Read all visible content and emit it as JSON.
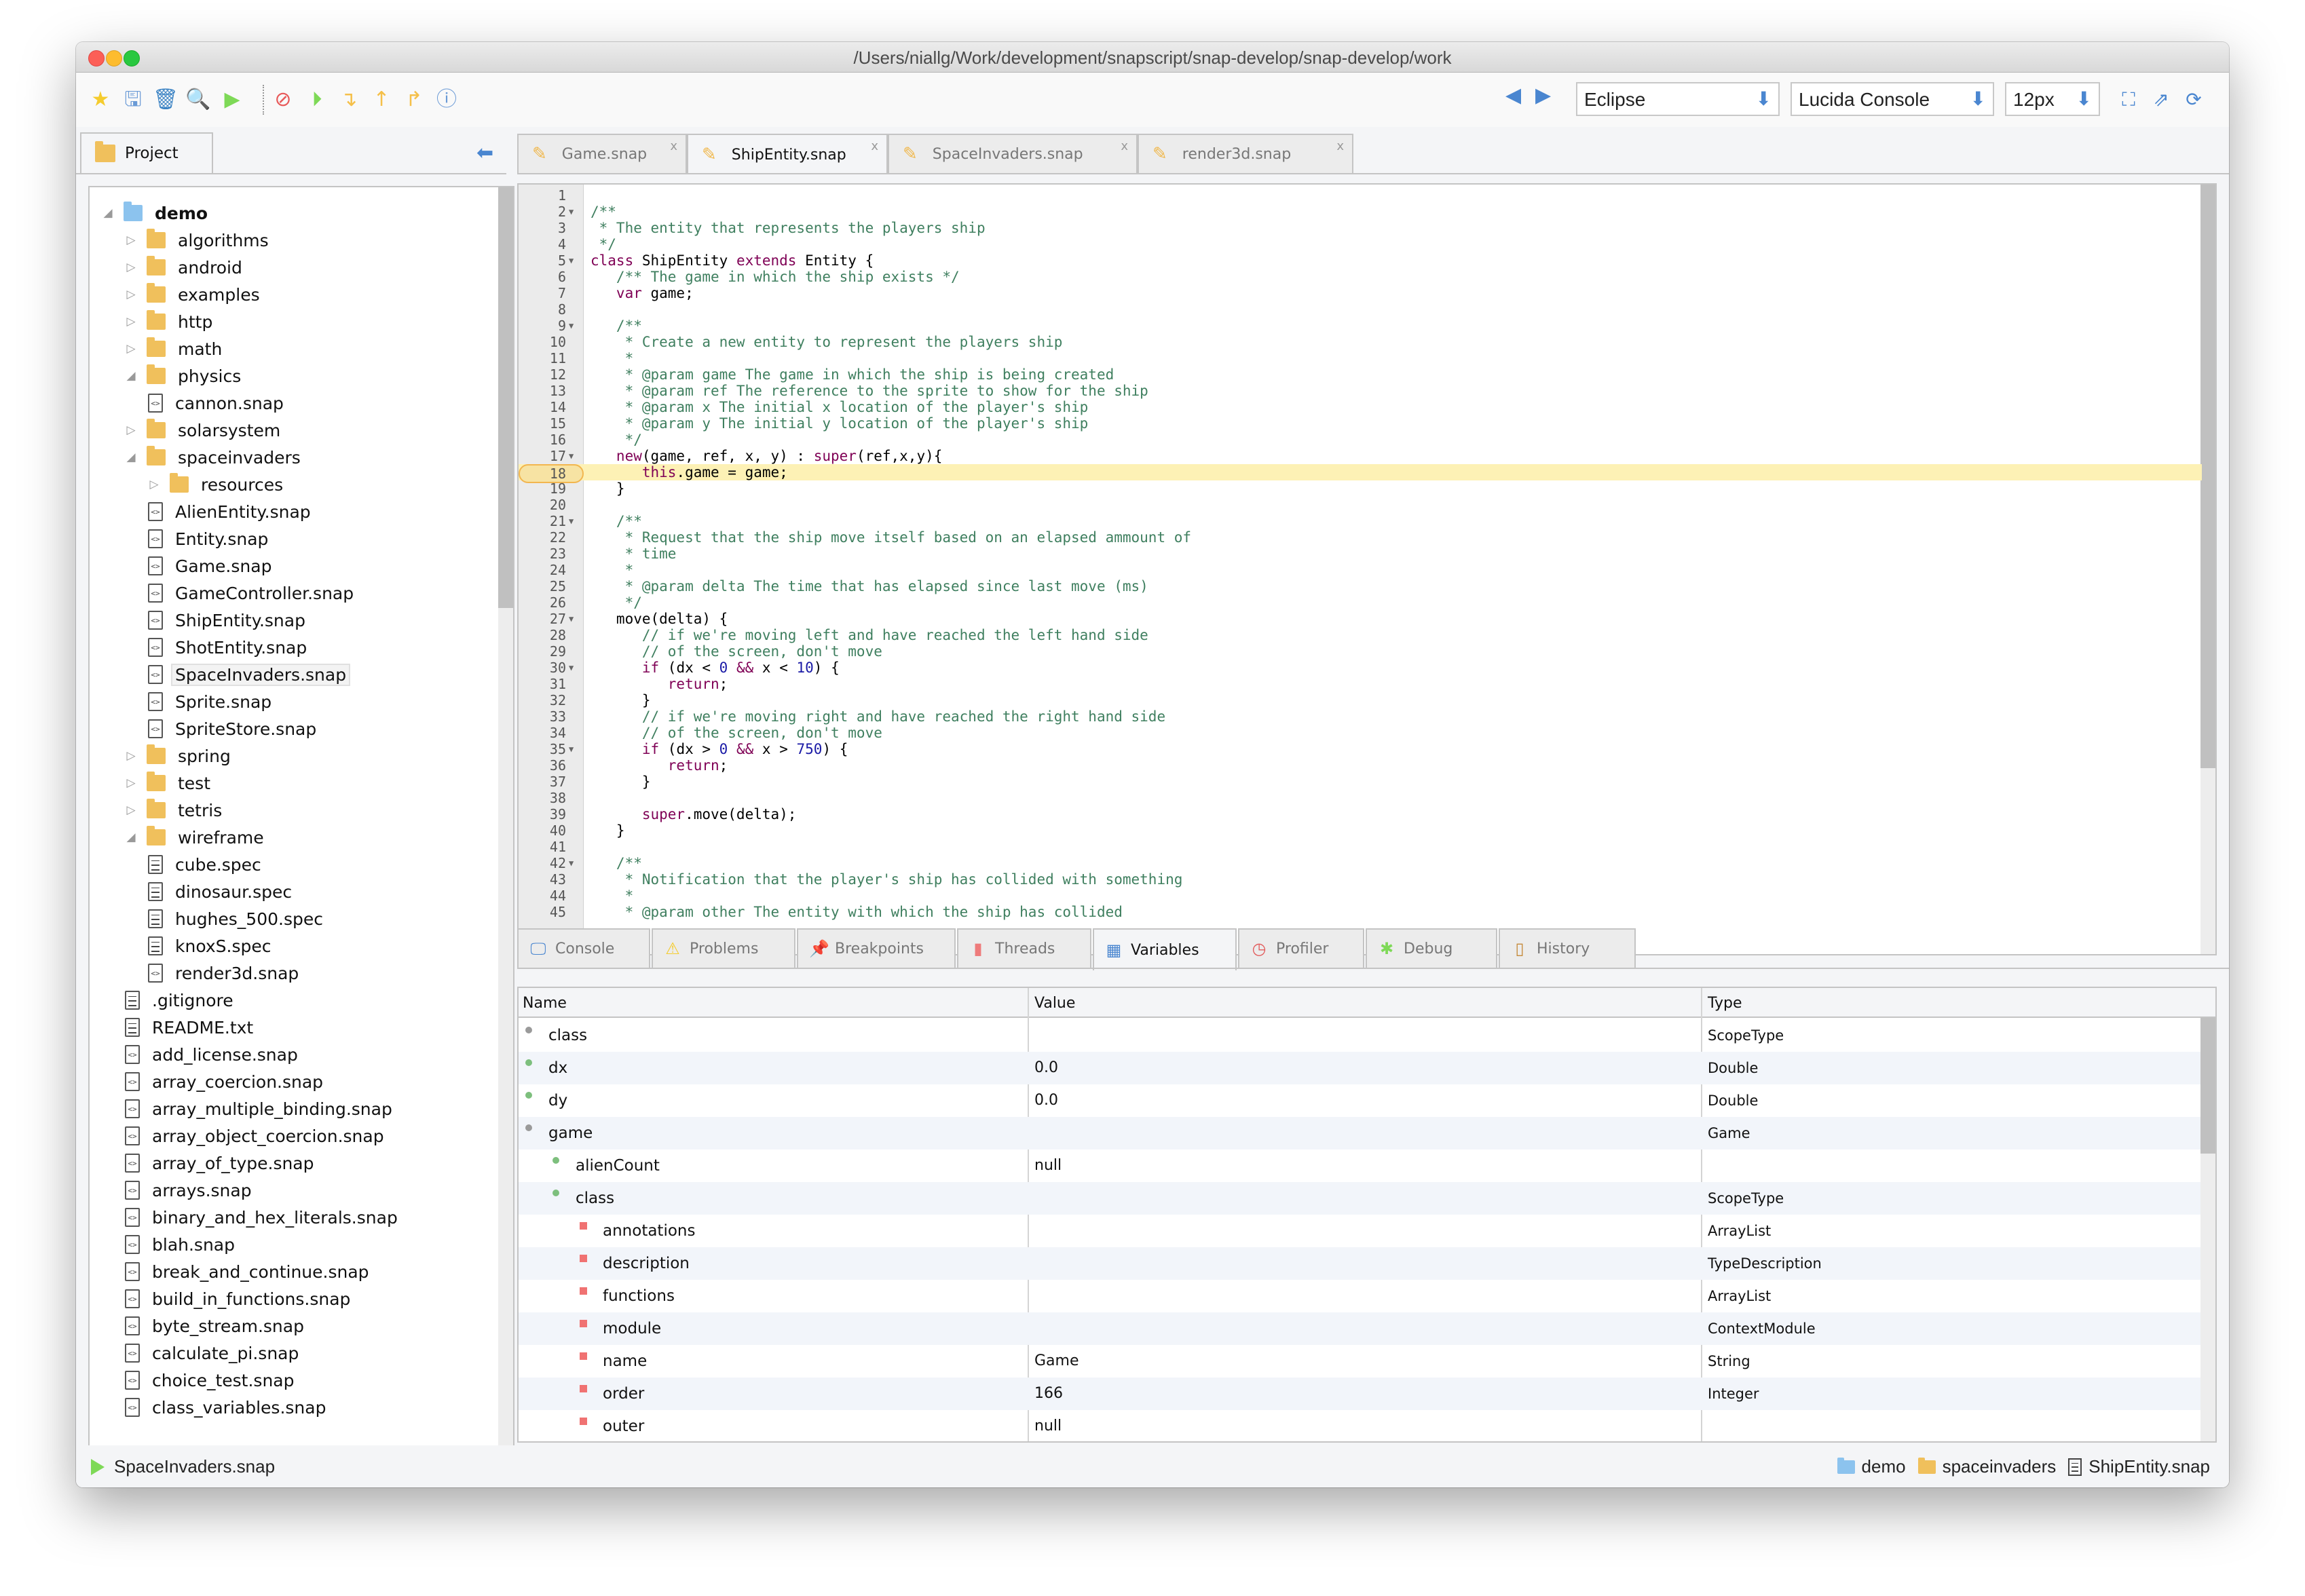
{
  "window": {
    "title": "/Users/niallg/Work/development/snapscript/snap-develop/snap-develop/work"
  },
  "toolbar": {
    "icons": [
      {
        "name": "star-icon",
        "glyph": "★",
        "color": "#f5cc2e"
      },
      {
        "name": "save-icon",
        "glyph": "🖫",
        "color": "#6a9ad6"
      },
      {
        "name": "trash-icon",
        "glyph": "🗑",
        "color": "#3b83c4"
      },
      {
        "name": "search-icon",
        "glyph": "🔍",
        "color": "#d48a3a"
      },
      {
        "name": "run-icon",
        "glyph": "▶",
        "color": "#7ed957"
      },
      {
        "name": "stop-icon",
        "glyph": "⊘",
        "color": "#e85a5a"
      },
      {
        "name": "resume-icon",
        "glyph": "⏵",
        "color": "#7ed957"
      },
      {
        "name": "step-into-icon",
        "glyph": "↴",
        "color": "#f5c04a"
      },
      {
        "name": "step-out-icon",
        "glyph": "↑",
        "color": "#f5c04a"
      },
      {
        "name": "step-over-icon",
        "glyph": "↱",
        "color": "#f5c04a"
      },
      {
        "name": "help-icon",
        "glyph": "ⓘ",
        "color": "#6a9ad6"
      }
    ],
    "theme_select": "Eclipse",
    "font_select": "Lucida Console",
    "size_select": "12px",
    "back_glyph": "◀",
    "forward_glyph": "▶",
    "right_icons": [
      {
        "name": "fullscreen-icon",
        "glyph": "⛶"
      },
      {
        "name": "external-link-icon",
        "glyph": "⇗"
      },
      {
        "name": "refresh-icon",
        "glyph": "⟳"
      }
    ],
    "dropdown_arrow": "⬇"
  },
  "project_panel": {
    "tab_label": "Project",
    "collapse_glyph": "⬅",
    "tree": [
      {
        "label": "demo",
        "depth": 0,
        "type": "root",
        "toggle": "open",
        "bold": true
      },
      {
        "label": "algorithms",
        "depth": 1,
        "type": "folder",
        "toggle": "closed"
      },
      {
        "label": "android",
        "depth": 1,
        "type": "folder",
        "toggle": "closed"
      },
      {
        "label": "examples",
        "depth": 1,
        "type": "folder",
        "toggle": "closed"
      },
      {
        "label": "http",
        "depth": 1,
        "type": "folder",
        "toggle": "closed"
      },
      {
        "label": "math",
        "depth": 1,
        "type": "folder",
        "toggle": "closed"
      },
      {
        "label": "physics",
        "depth": 1,
        "type": "folder",
        "toggle": "open"
      },
      {
        "label": "cannon.snap",
        "depth": 2,
        "type": "code"
      },
      {
        "label": "solarsystem",
        "depth": 1,
        "type": "folder",
        "toggle": "closed"
      },
      {
        "label": "spaceinvaders",
        "depth": 1,
        "type": "folder",
        "toggle": "open"
      },
      {
        "label": "resources",
        "depth": 2,
        "type": "folder",
        "toggle": "closed"
      },
      {
        "label": "AlienEntity.snap",
        "depth": 2,
        "type": "code"
      },
      {
        "label": "Entity.snap",
        "depth": 2,
        "type": "code"
      },
      {
        "label": "Game.snap",
        "depth": 2,
        "type": "code"
      },
      {
        "label": "GameController.snap",
        "depth": 2,
        "type": "code"
      },
      {
        "label": "ShipEntity.snap",
        "depth": 2,
        "type": "code"
      },
      {
        "label": "ShotEntity.snap",
        "depth": 2,
        "type": "code"
      },
      {
        "label": "SpaceInvaders.snap",
        "depth": 2,
        "type": "code",
        "selected": true
      },
      {
        "label": "Sprite.snap",
        "depth": 2,
        "type": "code"
      },
      {
        "label": "SpriteStore.snap",
        "depth": 2,
        "type": "code"
      },
      {
        "label": "spring",
        "depth": 1,
        "type": "folder",
        "toggle": "closed"
      },
      {
        "label": "test",
        "depth": 1,
        "type": "folder",
        "toggle": "closed"
      },
      {
        "label": "tetris",
        "depth": 1,
        "type": "folder",
        "toggle": "closed"
      },
      {
        "label": "wireframe",
        "depth": 1,
        "type": "folder",
        "toggle": "open"
      },
      {
        "label": "cube.spec",
        "depth": 2,
        "type": "text"
      },
      {
        "label": "dinosaur.spec",
        "depth": 2,
        "type": "text"
      },
      {
        "label": "hughes_500.spec",
        "depth": 2,
        "type": "text"
      },
      {
        "label": "knoxS.spec",
        "depth": 2,
        "type": "text"
      },
      {
        "label": "render3d.snap",
        "depth": 2,
        "type": "code"
      },
      {
        "label": ".gitignore",
        "depth": 1,
        "type": "text"
      },
      {
        "label": "README.txt",
        "depth": 1,
        "type": "text"
      },
      {
        "label": "add_license.snap",
        "depth": 1,
        "type": "code"
      },
      {
        "label": "array_coercion.snap",
        "depth": 1,
        "type": "code"
      },
      {
        "label": "array_multiple_binding.snap",
        "depth": 1,
        "type": "code"
      },
      {
        "label": "array_object_coercion.snap",
        "depth": 1,
        "type": "code"
      },
      {
        "label": "array_of_type.snap",
        "depth": 1,
        "type": "code"
      },
      {
        "label": "arrays.snap",
        "depth": 1,
        "type": "code"
      },
      {
        "label": "binary_and_hex_literals.snap",
        "depth": 1,
        "type": "code"
      },
      {
        "label": "blah.snap",
        "depth": 1,
        "type": "code"
      },
      {
        "label": "break_and_continue.snap",
        "depth": 1,
        "type": "code"
      },
      {
        "label": "build_in_functions.snap",
        "depth": 1,
        "type": "code"
      },
      {
        "label": "byte_stream.snap",
        "depth": 1,
        "type": "code"
      },
      {
        "label": "calculate_pi.snap",
        "depth": 1,
        "type": "code"
      },
      {
        "label": "choice_test.snap",
        "depth": 1,
        "type": "code"
      },
      {
        "label": "class_variables.snap",
        "depth": 1,
        "type": "code"
      }
    ]
  },
  "editor_tabs": [
    {
      "label": "Game.snap",
      "active": false
    },
    {
      "label": "ShipEntity.snap",
      "active": true
    },
    {
      "label": "SpaceInvaders.snap",
      "active": false
    },
    {
      "label": "render3d.snap",
      "active": false
    }
  ],
  "editor_tab_close": "x",
  "editor": {
    "highlighted_line": 18,
    "lines": [
      {
        "n": 1,
        "fold": false,
        "seg": []
      },
      {
        "n": 2,
        "fold": true,
        "seg": [
          [
            "c",
            "/**"
          ]
        ]
      },
      {
        "n": 3,
        "fold": false,
        "seg": [
          [
            "c",
            " * The entity that represents the players ship"
          ]
        ]
      },
      {
        "n": 4,
        "fold": false,
        "seg": [
          [
            "c",
            " */"
          ]
        ]
      },
      {
        "n": 5,
        "fold": true,
        "seg": [
          [
            "k",
            "class"
          ],
          [
            "p",
            " ShipEntity "
          ],
          [
            "k",
            "extends"
          ],
          [
            "p",
            " Entity {"
          ]
        ]
      },
      {
        "n": 6,
        "fold": false,
        "seg": [
          [
            "c",
            "   /** The game in which the ship exists */"
          ]
        ]
      },
      {
        "n": 7,
        "fold": false,
        "seg": [
          [
            "k",
            "   var"
          ],
          [
            "p",
            " game;"
          ]
        ]
      },
      {
        "n": 8,
        "fold": false,
        "seg": []
      },
      {
        "n": 9,
        "fold": true,
        "seg": [
          [
            "c",
            "   /**"
          ]
        ]
      },
      {
        "n": 10,
        "fold": false,
        "seg": [
          [
            "c",
            "    * Create a new entity to represent the players ship"
          ]
        ]
      },
      {
        "n": 11,
        "fold": false,
        "seg": [
          [
            "c",
            "    *"
          ]
        ]
      },
      {
        "n": 12,
        "fold": false,
        "seg": [
          [
            "c",
            "    * @param game The game in which the ship is being created"
          ]
        ]
      },
      {
        "n": 13,
        "fold": false,
        "seg": [
          [
            "c",
            "    * @param ref The reference to the sprite to show for the ship"
          ]
        ]
      },
      {
        "n": 14,
        "fold": false,
        "seg": [
          [
            "c",
            "    * @param x The initial x location of the player's ship"
          ]
        ]
      },
      {
        "n": 15,
        "fold": false,
        "seg": [
          [
            "c",
            "    * @param y The initial y location of the player's ship"
          ]
        ]
      },
      {
        "n": 16,
        "fold": false,
        "seg": [
          [
            "c",
            "    */"
          ]
        ]
      },
      {
        "n": 17,
        "fold": true,
        "seg": [
          [
            "k",
            "   new"
          ],
          [
            "p",
            "(game, ref, x, y) : "
          ],
          [
            "k",
            "super"
          ],
          [
            "p",
            "(ref,x,y){"
          ]
        ]
      },
      {
        "n": 18,
        "fold": false,
        "seg": [
          [
            "k",
            "      this"
          ],
          [
            "p",
            ".game = game;"
          ]
        ]
      },
      {
        "n": 19,
        "fold": false,
        "seg": [
          [
            "p",
            "   }"
          ]
        ]
      },
      {
        "n": 20,
        "fold": false,
        "seg": []
      },
      {
        "n": 21,
        "fold": true,
        "seg": [
          [
            "c",
            "   /**"
          ]
        ]
      },
      {
        "n": 22,
        "fold": false,
        "seg": [
          [
            "c",
            "    * Request that the ship move itself based on an elapsed ammount of"
          ]
        ]
      },
      {
        "n": 23,
        "fold": false,
        "seg": [
          [
            "c",
            "    * time"
          ]
        ]
      },
      {
        "n": 24,
        "fold": false,
        "seg": [
          [
            "c",
            "    *"
          ]
        ]
      },
      {
        "n": 25,
        "fold": false,
        "seg": [
          [
            "c",
            "    * @param delta The time that has elapsed since last move (ms)"
          ]
        ]
      },
      {
        "n": 26,
        "fold": false,
        "seg": [
          [
            "c",
            "    */"
          ]
        ]
      },
      {
        "n": 27,
        "fold": true,
        "seg": [
          [
            "p",
            "   move(delta) {"
          ]
        ]
      },
      {
        "n": 28,
        "fold": false,
        "seg": [
          [
            "c",
            "      // if we're moving left and have reached the left hand side"
          ]
        ]
      },
      {
        "n": 29,
        "fold": false,
        "seg": [
          [
            "c",
            "      // of the screen, don't move"
          ]
        ]
      },
      {
        "n": 30,
        "fold": true,
        "seg": [
          [
            "k",
            "      if"
          ],
          [
            "p",
            " (dx < "
          ],
          [
            "n",
            "0"
          ],
          [
            "p",
            " "
          ],
          [
            "k",
            "&&"
          ],
          [
            "p",
            " x < "
          ],
          [
            "n",
            "10"
          ],
          [
            "p",
            ") {"
          ]
        ]
      },
      {
        "n": 31,
        "fold": false,
        "seg": [
          [
            "k",
            "         return"
          ],
          [
            "p",
            ";"
          ]
        ]
      },
      {
        "n": 32,
        "fold": false,
        "seg": [
          [
            "p",
            "      }"
          ]
        ]
      },
      {
        "n": 33,
        "fold": false,
        "seg": [
          [
            "c",
            "      // if we're moving right and have reached the right hand side"
          ]
        ]
      },
      {
        "n": 34,
        "fold": false,
        "seg": [
          [
            "c",
            "      // of the screen, don't move"
          ]
        ]
      },
      {
        "n": 35,
        "fold": true,
        "seg": [
          [
            "k",
            "      if"
          ],
          [
            "p",
            " (dx > "
          ],
          [
            "n",
            "0"
          ],
          [
            "p",
            " "
          ],
          [
            "k",
            "&&"
          ],
          [
            "p",
            " x > "
          ],
          [
            "n",
            "750"
          ],
          [
            "p",
            ") {"
          ]
        ]
      },
      {
        "n": 36,
        "fold": false,
        "seg": [
          [
            "k",
            "         return"
          ],
          [
            "p",
            ";"
          ]
        ]
      },
      {
        "n": 37,
        "fold": false,
        "seg": [
          [
            "p",
            "      }"
          ]
        ]
      },
      {
        "n": 38,
        "fold": false,
        "seg": []
      },
      {
        "n": 39,
        "fold": false,
        "seg": [
          [
            "k",
            "      super"
          ],
          [
            "p",
            ".move(delta);"
          ]
        ]
      },
      {
        "n": 40,
        "fold": false,
        "seg": [
          [
            "p",
            "   }"
          ]
        ]
      },
      {
        "n": 41,
        "fold": false,
        "seg": []
      },
      {
        "n": 42,
        "fold": true,
        "seg": [
          [
            "c",
            "   /**"
          ]
        ]
      },
      {
        "n": 43,
        "fold": false,
        "seg": [
          [
            "c",
            "    * Notification that the player's ship has collided with something"
          ]
        ]
      },
      {
        "n": 44,
        "fold": false,
        "seg": [
          [
            "c",
            "    *"
          ]
        ]
      },
      {
        "n": 45,
        "fold": false,
        "seg": [
          [
            "c",
            "    * @param other The entity with which the ship has collided"
          ]
        ]
      }
    ]
  },
  "bottom_tabs": [
    {
      "label": "Console",
      "icon": "console-icon",
      "glyph": "🖵",
      "color": "#4a86d0",
      "active": false
    },
    {
      "label": "Problems",
      "icon": "warning-icon",
      "glyph": "⚠",
      "color": "#f5cc2e",
      "active": false
    },
    {
      "label": "Breakpoints",
      "icon": "pin-icon",
      "glyph": "📌",
      "color": "#7ed957",
      "active": false
    },
    {
      "label": "Threads",
      "icon": "threads-icon",
      "glyph": "▮",
      "color": "#ee7b7b",
      "active": false
    },
    {
      "label": "Variables",
      "icon": "calculator-icon",
      "glyph": "▦",
      "color": "#4a86d0",
      "active": true
    },
    {
      "label": "Profiler",
      "icon": "clock-icon",
      "glyph": "◷",
      "color": "#e25b5b",
      "active": false
    },
    {
      "label": "Debug",
      "icon": "bug-icon",
      "glyph": "✱",
      "color": "#7ed957",
      "active": false
    },
    {
      "label": "History",
      "icon": "book-icon",
      "glyph": "▯",
      "color": "#c58a3a",
      "active": false
    }
  ],
  "variables": {
    "columns": [
      "Name",
      "Value",
      "Type"
    ],
    "rows": [
      {
        "name": "class",
        "value": "",
        "type": "ScopeType",
        "depth": 0,
        "bullet": "gray"
      },
      {
        "name": "dx",
        "value": "0.0",
        "type": "Double",
        "depth": 0,
        "bullet": "green"
      },
      {
        "name": "dy",
        "value": "0.0",
        "type": "Double",
        "depth": 0,
        "bullet": "green"
      },
      {
        "name": "game",
        "value": "",
        "type": "Game",
        "depth": 0,
        "bullet": "gray"
      },
      {
        "name": "alienCount",
        "value": "null",
        "type": "",
        "depth": 1,
        "bullet": "green"
      },
      {
        "name": "class",
        "value": "",
        "type": "ScopeType",
        "depth": 1,
        "bullet": "green"
      },
      {
        "name": "annotations",
        "value": "",
        "type": "ArrayList",
        "depth": 2,
        "bullet": "red"
      },
      {
        "name": "description",
        "value": "",
        "type": "TypeDescription",
        "depth": 2,
        "bullet": "red"
      },
      {
        "name": "functions",
        "value": "",
        "type": "ArrayList",
        "depth": 2,
        "bullet": "red"
      },
      {
        "name": "module",
        "value": "",
        "type": "ContextModule",
        "depth": 2,
        "bullet": "red"
      },
      {
        "name": "name",
        "value": "Game",
        "type": "String",
        "depth": 2,
        "bullet": "red"
      },
      {
        "name": "order",
        "value": "166",
        "type": "Integer",
        "depth": 2,
        "bullet": "red"
      },
      {
        "name": "outer",
        "value": "null",
        "type": "",
        "depth": 2,
        "bullet": "red"
      }
    ]
  },
  "statusbar": {
    "running": "SpaceInvaders.snap",
    "breadcrumb": [
      "demo",
      "spaceinvaders",
      "ShipEntity.snap"
    ]
  }
}
